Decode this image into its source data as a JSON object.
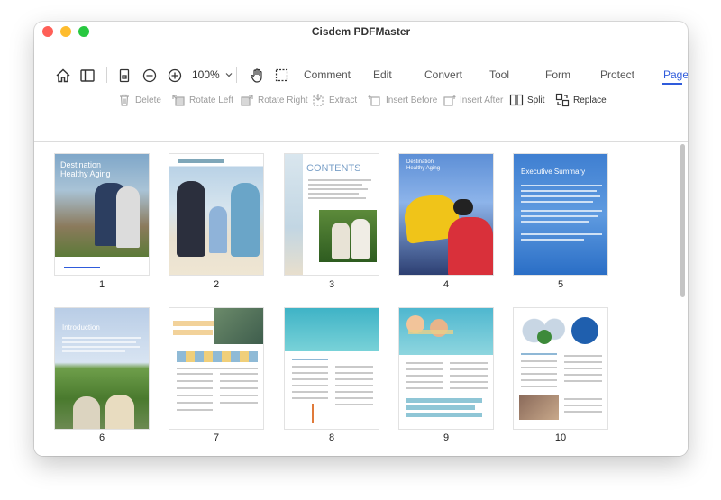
{
  "app": {
    "title": "Cisdem PDFMaster"
  },
  "colors": {
    "close": "#ff5f57",
    "minimize": "#febc2e",
    "maximize": "#28c840",
    "accent": "#2f5bdb"
  },
  "toolbar": {
    "icons": [
      "home-icon",
      "sidebar-icon",
      "page-view-icon",
      "zoom-out-icon",
      "zoom-in-icon",
      "hand-icon",
      "selection-icon"
    ],
    "zoom": "100%",
    "tabs": [
      "Comment",
      "Edit",
      "Convert",
      "Tool",
      "Form",
      "Protect",
      "Page"
    ],
    "active_tab": "Page"
  },
  "page_actions": [
    {
      "label": "Delete",
      "icon": "trash-icon",
      "enabled": false
    },
    {
      "label": "Rotate Left",
      "icon": "rotate-left-icon",
      "enabled": false
    },
    {
      "label": "Rotate Right",
      "icon": "rotate-right-icon",
      "enabled": false
    },
    {
      "label": "Extract",
      "icon": "extract-icon",
      "enabled": false
    },
    {
      "label": "Insert Before",
      "icon": "insert-before-icon",
      "enabled": false
    },
    {
      "label": "Insert After",
      "icon": "insert-after-icon",
      "enabled": false
    },
    {
      "label": "Split",
      "icon": "split-icon",
      "enabled": true
    },
    {
      "label": "Replace",
      "icon": "replace-icon",
      "enabled": true
    }
  ],
  "pages": [
    {
      "number": "1",
      "heading": "Destination\nHealthy Aging"
    },
    {
      "number": "2"
    },
    {
      "number": "3",
      "heading": "CONTENTS"
    },
    {
      "number": "4",
      "heading": "Destination\nHealthy Aging"
    },
    {
      "number": "5",
      "heading": "Executive Summary"
    },
    {
      "number": "6",
      "heading": "Introduction"
    },
    {
      "number": "7"
    },
    {
      "number": "8"
    },
    {
      "number": "9"
    },
    {
      "number": "10"
    }
  ],
  "page_indicator": "1"
}
